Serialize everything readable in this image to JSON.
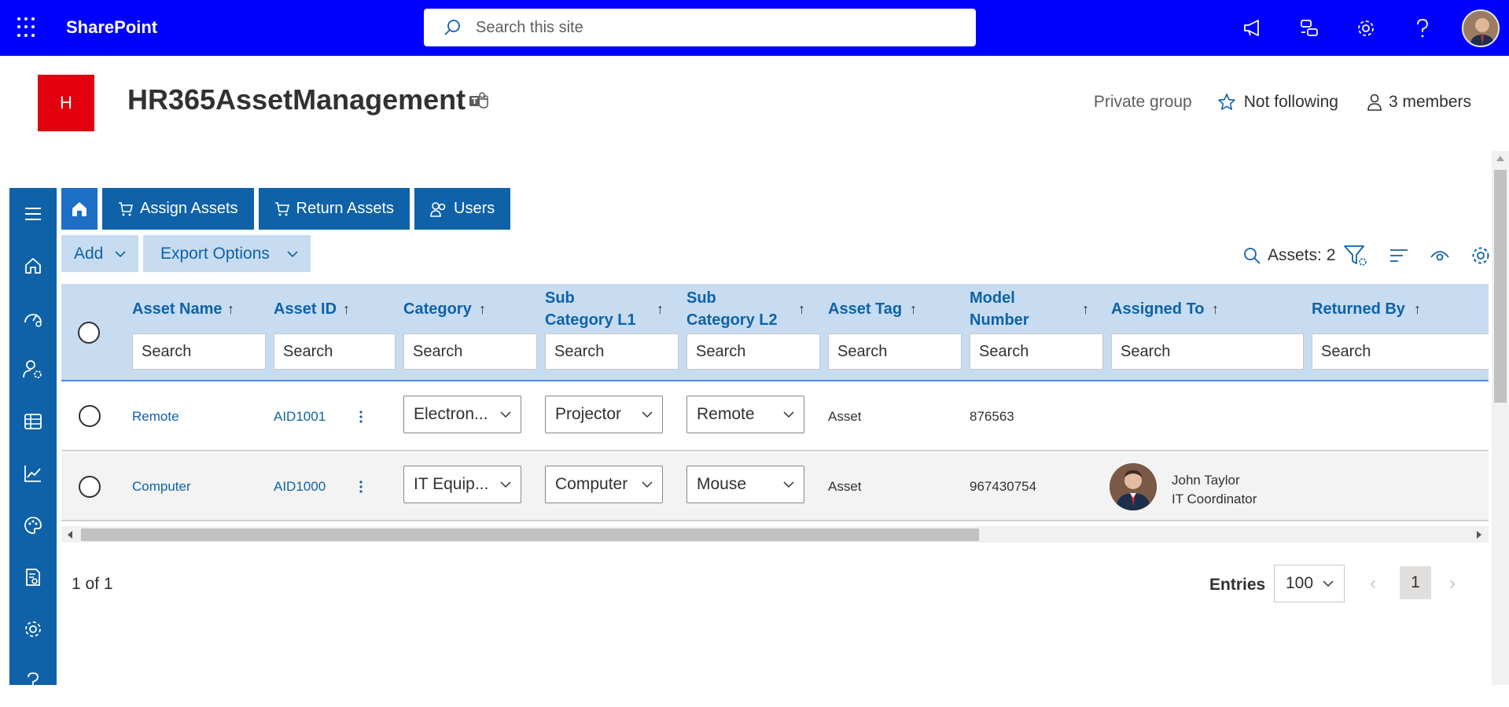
{
  "suitebar": {
    "brand": "SharePoint",
    "search_placeholder": "Search this site"
  },
  "site": {
    "logo_letter": "H",
    "title": "HR365AssetManagement",
    "privacy": "Private group",
    "follow": "Not following",
    "members": "3 members"
  },
  "nav": {
    "assign": "Assign Assets",
    "return": "Return Assets",
    "users": "Users"
  },
  "actions": {
    "add": "Add",
    "export": "Export Options",
    "assets_count": "Assets: 2"
  },
  "table": {
    "columns": [
      {
        "label": "Asset Name",
        "placeholder": "Search"
      },
      {
        "label": "Asset ID",
        "placeholder": "Search"
      },
      {
        "label": "Category",
        "placeholder": "Search"
      },
      {
        "label": "Sub Category L1",
        "placeholder": "Search"
      },
      {
        "label": "Sub Category L2",
        "placeholder": "Search"
      },
      {
        "label": "Asset Tag",
        "placeholder": "Search"
      },
      {
        "label": "Model Number",
        "placeholder": "Search"
      },
      {
        "label": "Assigned To",
        "placeholder": "Search"
      },
      {
        "label": "Returned By",
        "placeholder": "Search"
      }
    ],
    "rows": [
      {
        "asset_name": "Remote",
        "asset_id": "AID1001",
        "category": "Electron...",
        "sub1": "Projector",
        "sub2": "Remote",
        "asset_tag": "Asset",
        "model": "876563",
        "assigned_name": "",
        "assigned_title": ""
      },
      {
        "asset_name": "Computer",
        "asset_id": "AID1000",
        "category": "IT Equip...",
        "sub1": "Computer",
        "sub2": "Mouse",
        "asset_tag": "Asset",
        "model": "967430754",
        "assigned_name": "John Taylor",
        "assigned_title": "IT Coordinator"
      }
    ]
  },
  "footer": {
    "page_info": "1 of 1",
    "entries_label": "Entries",
    "entries_value": "100",
    "current_page": "1"
  },
  "colors": {
    "suitebar": "#0000fe",
    "rail": "#0f62a8",
    "header_bg": "#c7dcf1",
    "logo": "#e3000f"
  }
}
